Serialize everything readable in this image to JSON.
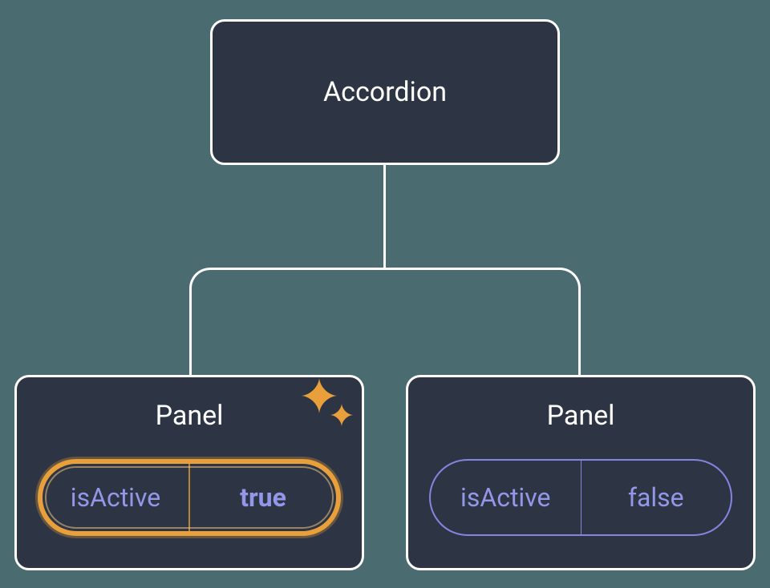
{
  "diagram": {
    "root": {
      "label": "Accordion"
    },
    "children": [
      {
        "label": "Panel",
        "state": {
          "key": "isActive",
          "value": "true"
        },
        "highlighted": true
      },
      {
        "label": "Panel",
        "state": {
          "key": "isActive",
          "value": "false"
        },
        "highlighted": false
      }
    ]
  }
}
